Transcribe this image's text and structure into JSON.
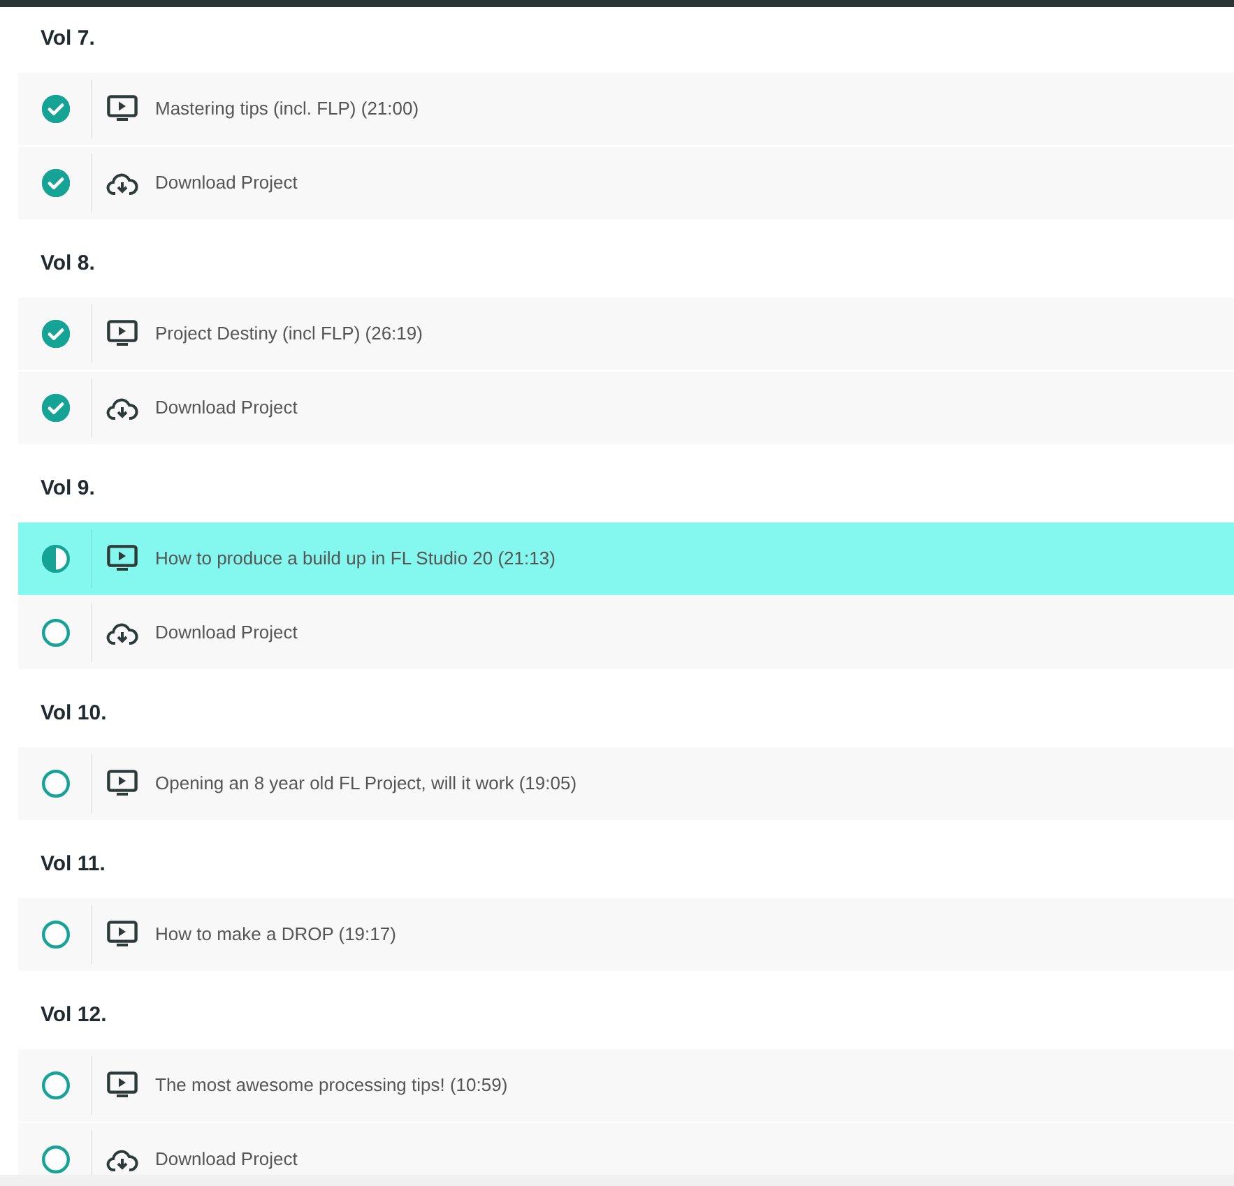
{
  "sections": [
    {
      "title": "Vol 7.",
      "lessons": [
        {
          "kind": "video",
          "title": "Mastering tips (incl. FLP) (21:00)",
          "level": 1,
          "selected": false
        },
        {
          "kind": "download",
          "title": "Download Project",
          "level": 1,
          "selected": false
        }
      ]
    },
    {
      "title": "Vol 8.",
      "lessons": [
        {
          "kind": "video",
          "title": "Project Destiny (incl FLP) (26:19)",
          "level": 1,
          "selected": false
        },
        {
          "kind": "download",
          "title": "Download Project",
          "level": 1,
          "selected": false
        }
      ]
    },
    {
      "title": "Vol 9.",
      "lessons": [
        {
          "kind": "video",
          "title": "How to produce a build up in FL Studio 20 (21:13)",
          "level": 0.5,
          "selected": true
        },
        {
          "kind": "download",
          "title": "Download Project",
          "level": 0,
          "selected": false
        }
      ]
    },
    {
      "title": "Vol 10.",
      "lessons": [
        {
          "kind": "video",
          "title": "Opening an 8 year old FL Project, will it work (19:05)",
          "level": 0,
          "selected": false
        }
      ]
    },
    {
      "title": "Vol 11.",
      "lessons": [
        {
          "kind": "video",
          "title": "How to make a DROP (19:17)",
          "level": 0,
          "selected": false
        }
      ]
    },
    {
      "title": "Vol 12.",
      "lessons": [
        {
          "kind": "video",
          "title": "The most awesome processing tips! (10:59)",
          "level": 0,
          "selected": false
        },
        {
          "kind": "download",
          "title": "Download Project",
          "level": 0,
          "selected": false
        }
      ]
    }
  ]
}
